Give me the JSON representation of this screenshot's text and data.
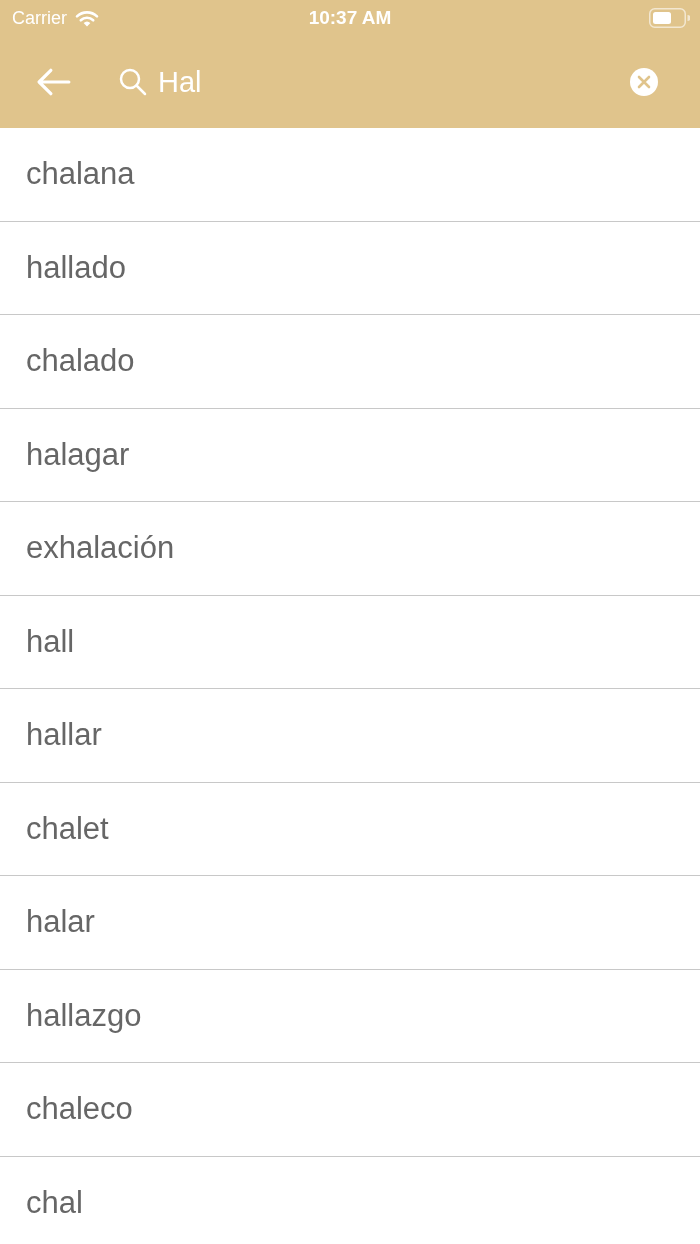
{
  "status_bar": {
    "carrier": "Carrier",
    "time": "10:37 AM"
  },
  "search_bar": {
    "value": "Hal"
  },
  "results": [
    "chalana",
    "hallado",
    "chalado",
    "halagar",
    "exhalación",
    "hall",
    "hallar",
    "chalet",
    "halar",
    "hallazgo",
    "chaleco",
    "chal"
  ]
}
